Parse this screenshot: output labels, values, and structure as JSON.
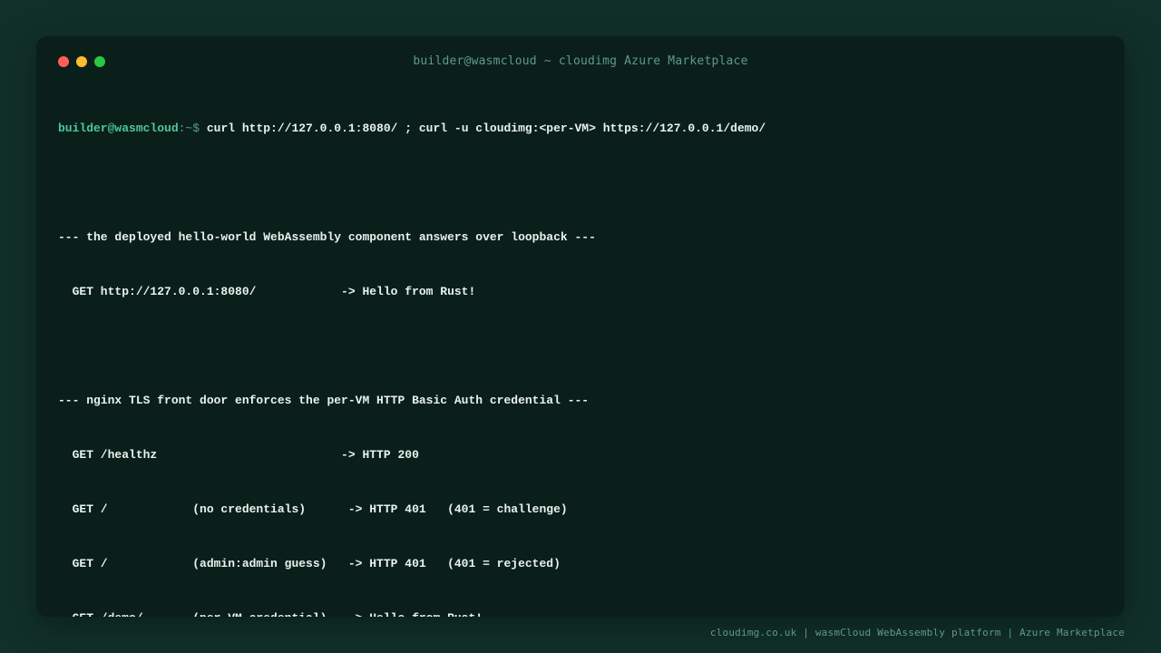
{
  "window": {
    "title": "builder@wasmcloud ~ cloudimg Azure Marketplace"
  },
  "terminal": {
    "prompt_user": "builder@wasmcloud",
    "prompt_path": ":~$ ",
    "command": "curl http://127.0.0.1:8080/ ; curl -u cloudimg:<per-VM> https://127.0.0.1/demo/",
    "section1": {
      "header": "--- the deployed hello-world WebAssembly component answers over loopback ---",
      "lines": [
        "  GET http://127.0.0.1:8080/            -> Hello from Rust!"
      ]
    },
    "section2": {
      "header": "--- nginx TLS front door enforces the per-VM HTTP Basic Auth credential ---",
      "lines": [
        "  GET /healthz                          -> HTTP 200",
        "  GET /            (no credentials)      -> HTTP 401   (401 = challenge)",
        "  GET /            (admin:admin guess)   -> HTTP 401   (401 = rejected)",
        "  GET /demo/       (per-VM credential)   -> Hello from Rust!"
      ]
    }
  },
  "footer": {
    "text": "cloudimg.co.uk | wasmCloud WebAssembly platform | Azure Marketplace"
  },
  "colors": {
    "background": "#11302a",
    "window": "#0a1f1a",
    "prompt_green": "#4fc79a",
    "muted": "#5f9a88",
    "text": "#e8f2ee",
    "close": "#ff5f57",
    "minimize": "#febc2e",
    "maximize": "#28c840"
  }
}
